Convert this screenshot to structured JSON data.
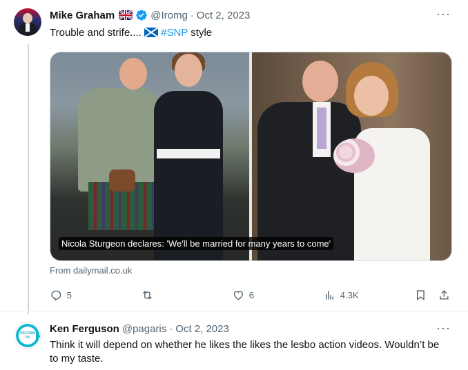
{
  "tweet1": {
    "author_name": "Mike Graham",
    "flag_icon": "uk-flag-icon",
    "verified_icon": "verified-badge-icon",
    "handle": "@Iromg",
    "separator": "·",
    "date": "Oct 2, 2023",
    "text_before": "Trouble and strife.... ",
    "text_hashtag": "#SNP",
    "text_after": " style",
    "link_card": {
      "caption": "Nicola Sturgeon declares: 'We'll be married for many years to come'",
      "source": "From dailymail.co.uk"
    },
    "actions": {
      "reply_count": "5",
      "retweet_count": "",
      "like_count": "6",
      "views_count": "4.3K"
    }
  },
  "tweet2": {
    "author_name": "Ken Ferguson",
    "handle": "@pagaris",
    "separator": "·",
    "date": "Oct 2, 2023",
    "text": "Think it will depend on whether he likes the likes the lesbo action videos. Wouldn’t be to my taste.",
    "avatar_label": "REFORM UK"
  },
  "more_label": "···",
  "colors": {
    "accent": "#1d9bf0",
    "secondary_text": "#536471",
    "primary_text": "#0f1419"
  }
}
